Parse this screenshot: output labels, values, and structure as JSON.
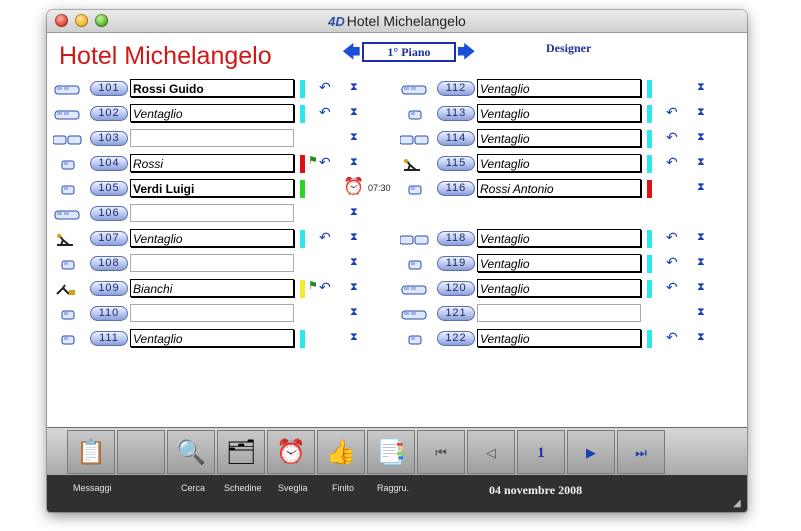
{
  "window": {
    "title": "Hotel Michelangelo",
    "logo": "4D"
  },
  "header": {
    "hotel_title": "Hotel Michelangelo",
    "floor": "1° Piano",
    "mode": "Designer"
  },
  "rooms_left": [
    {
      "number": "101",
      "name": "Rossi  Guido",
      "style": "bold",
      "status_color": "#2ee6ee",
      "flag": false,
      "back": true,
      "bed": "double"
    },
    {
      "number": "102",
      "name": "Ventaglio",
      "style": "italic",
      "status_color": "#2ee6ee",
      "flag": false,
      "back": true,
      "bed": "double"
    },
    {
      "number": "103",
      "name": "",
      "style": "empty",
      "status_color": "",
      "flag": false,
      "back": false,
      "bed": "triple"
    },
    {
      "number": "104",
      "name": "Rossi",
      "style": "italic",
      "status_color": "#e01010",
      "flag": true,
      "back": true,
      "bed": "single"
    },
    {
      "number": "105",
      "name": "Verdi  Luigi",
      "style": "bold",
      "status_color": "#2bd62b",
      "flag": false,
      "back": false,
      "bed": "single",
      "clock": "07:30"
    },
    {
      "number": "106",
      "name": "",
      "style": "empty",
      "status_color": "",
      "flag": false,
      "back": false,
      "bed": "double"
    },
    {
      "number": "107",
      "name": "Ventaglio",
      "style": "italic",
      "status_color": "#2ee6ee",
      "flag": false,
      "back": true,
      "bed": "cleaner"
    },
    {
      "number": "108",
      "name": "",
      "style": "empty",
      "status_color": "",
      "flag": false,
      "back": false,
      "bed": "single"
    },
    {
      "number": "109",
      "name": "Bianchi",
      "style": "italic",
      "status_color": "#f2ea2a",
      "flag": true,
      "back": true,
      "bed": "cleaner2"
    },
    {
      "number": "110",
      "name": "",
      "style": "empty",
      "status_color": "",
      "flag": false,
      "back": false,
      "bed": "single"
    },
    {
      "number": "111",
      "name": "Ventaglio",
      "style": "italic",
      "status_color": "#2ee6ee",
      "flag": false,
      "back": false,
      "bed": "single"
    }
  ],
  "rooms_right": [
    {
      "number": "112",
      "name": "Ventaglio",
      "style": "italic",
      "status_color": "#2ee6ee",
      "flag": false,
      "back": false,
      "bed": "double"
    },
    {
      "number": "113",
      "name": "Ventaglio",
      "style": "italic",
      "status_color": "#2ee6ee",
      "flag": false,
      "back": true,
      "bed": "single"
    },
    {
      "number": "114",
      "name": "Ventaglio",
      "style": "italic",
      "status_color": "#2ee6ee",
      "flag": false,
      "back": true,
      "bed": "triple"
    },
    {
      "number": "115",
      "name": "Ventaglio",
      "style": "italic",
      "status_color": "#2ee6ee",
      "flag": false,
      "back": true,
      "bed": "cleaner"
    },
    {
      "number": "116",
      "name": "Rossi  Antonio",
      "style": "italic",
      "status_color": "#e01010",
      "flag": false,
      "back": false,
      "bed": "single"
    },
    {
      "number": "118",
      "name": "Ventaglio",
      "style": "italic",
      "status_color": "#2ee6ee",
      "flag": false,
      "back": true,
      "bed": "triple"
    },
    {
      "number": "119",
      "name": "Ventaglio",
      "style": "italic",
      "status_color": "#2ee6ee",
      "flag": false,
      "back": true,
      "bed": "single"
    },
    {
      "number": "120",
      "name": "Ventaglio",
      "style": "italic",
      "status_color": "#2ee6ee",
      "flag": false,
      "back": true,
      "bed": "double"
    },
    {
      "number": "121",
      "name": "",
      "style": "empty",
      "status_color": "",
      "flag": false,
      "back": false,
      "bed": "double"
    },
    {
      "number": "122",
      "name": "Ventaglio",
      "style": "italic",
      "status_color": "#2ee6ee",
      "flag": false,
      "back": true,
      "bed": "single"
    }
  ],
  "toolbar": {
    "messaggi": "Messaggi",
    "cerca": "Cerca",
    "schedine": "Schedine",
    "sveglia": "Sveglia",
    "finito": "Finito",
    "raggru": "Raggru.",
    "page_number": "1",
    "date": "04 novembre 2008"
  }
}
